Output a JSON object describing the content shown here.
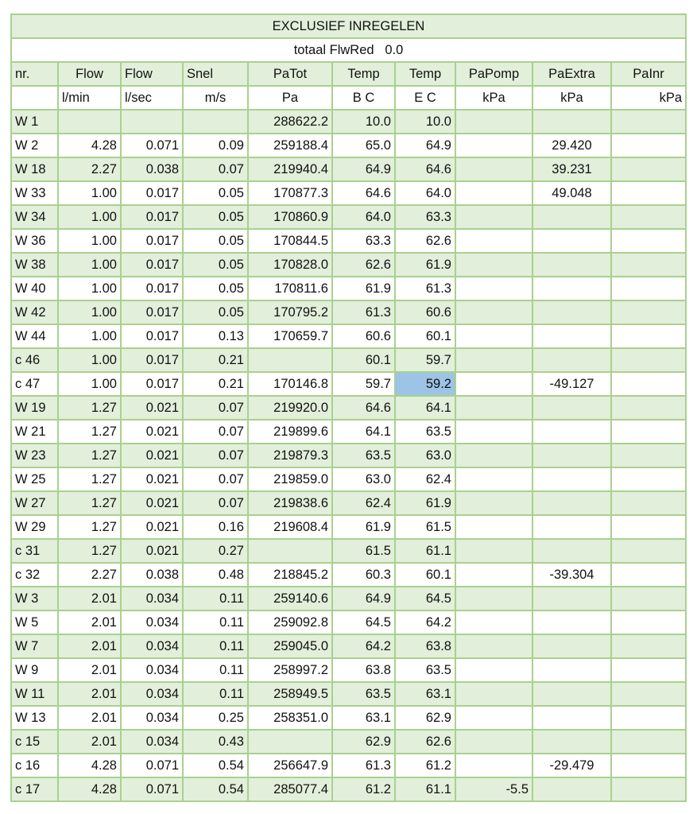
{
  "title": "EXCLUSIEF INREGELEN",
  "subtitle": "totaal FlwRed   0.0",
  "headers": [
    "nr.",
    "Flow",
    "Flow",
    "Snel",
    "PaTot",
    "Temp",
    "Temp",
    "PaPomp",
    "PaExtra",
    "PaInr"
  ],
  "units": [
    "",
    "l/min",
    "l/sec",
    "m/s",
    "Pa",
    "B C",
    "E C",
    "kPa",
    "kPa",
    "kPa"
  ],
  "rows": [
    [
      "W  1",
      "",
      "",
      "",
      "288622.2",
      "10.0",
      "10.0",
      "",
      "",
      ""
    ],
    [
      "W  2",
      "4.28",
      "0.071",
      "0.09",
      "259188.4",
      "65.0",
      "64.9",
      "",
      "29.420",
      ""
    ],
    [
      "W 18",
      "2.27",
      "0.038",
      "0.07",
      "219940.4",
      "64.9",
      "64.6",
      "",
      "39.231",
      ""
    ],
    [
      "W 33",
      "1.00",
      "0.017",
      "0.05",
      "170877.3",
      "64.6",
      "64.0",
      "",
      "49.048",
      ""
    ],
    [
      "W 34",
      "1.00",
      "0.017",
      "0.05",
      "170860.9",
      "64.0",
      "63.3",
      "",
      "",
      ""
    ],
    [
      "W 36",
      "1.00",
      "0.017",
      "0.05",
      "170844.5",
      "63.3",
      "62.6",
      "",
      "",
      ""
    ],
    [
      "W 38",
      "1.00",
      "0.017",
      "0.05",
      "170828.0",
      "62.6",
      "61.9",
      "",
      "",
      ""
    ],
    [
      "W 40",
      "1.00",
      "0.017",
      "0.05",
      "170811.6",
      "61.9",
      "61.3",
      "",
      "",
      ""
    ],
    [
      "W 42",
      "1.00",
      "0.017",
      "0.05",
      "170795.2",
      "61.3",
      "60.6",
      "",
      "",
      ""
    ],
    [
      "W 44",
      "1.00",
      "0.017",
      "0.13",
      "170659.7",
      "60.6",
      "60.1",
      "",
      "",
      ""
    ],
    [
      "c 46",
      "1.00",
      "0.017",
      "0.21",
      "",
      "60.1",
      "59.7",
      "",
      "",
      ""
    ],
    [
      "c 47",
      "1.00",
      "0.017",
      "0.21",
      "170146.8",
      "59.7",
      "59.2",
      "",
      "-49.127",
      ""
    ],
    [
      "W 19",
      "1.27",
      "0.021",
      "0.07",
      "219920.0",
      "64.6",
      "64.1",
      "",
      "",
      ""
    ],
    [
      "W 21",
      "1.27",
      "0.021",
      "0.07",
      "219899.6",
      "64.1",
      "63.5",
      "",
      "",
      ""
    ],
    [
      "W 23",
      "1.27",
      "0.021",
      "0.07",
      "219879.3",
      "63.5",
      "63.0",
      "",
      "",
      ""
    ],
    [
      "W 25",
      "1.27",
      "0.021",
      "0.07",
      "219859.0",
      "63.0",
      "62.4",
      "",
      "",
      ""
    ],
    [
      "W 27",
      "1.27",
      "0.021",
      "0.07",
      "219838.6",
      "62.4",
      "61.9",
      "",
      "",
      ""
    ],
    [
      "W 29",
      "1.27",
      "0.021",
      "0.16",
      "219608.4",
      "61.9",
      "61.5",
      "",
      "",
      ""
    ],
    [
      "c 31",
      "1.27",
      "0.021",
      "0.27",
      "",
      "61.5",
      "61.1",
      "",
      "",
      ""
    ],
    [
      "c 32",
      "2.27",
      "0.038",
      "0.48",
      "218845.2",
      "60.3",
      "60.1",
      "",
      "-39.304",
      ""
    ],
    [
      "W  3",
      "2.01",
      "0.034",
      "0.11",
      "259140.6",
      "64.9",
      "64.5",
      "",
      "",
      ""
    ],
    [
      "W  5",
      "2.01",
      "0.034",
      "0.11",
      "259092.8",
      "64.5",
      "64.2",
      "",
      "",
      ""
    ],
    [
      "W  7",
      "2.01",
      "0.034",
      "0.11",
      "259045.0",
      "64.2",
      "63.8",
      "",
      "",
      ""
    ],
    [
      "W  9",
      "2.01",
      "0.034",
      "0.11",
      "258997.2",
      "63.8",
      "63.5",
      "",
      "",
      ""
    ],
    [
      "W 11",
      "2.01",
      "0.034",
      "0.11",
      "258949.5",
      "63.5",
      "63.1",
      "",
      "",
      ""
    ],
    [
      "W 13",
      "2.01",
      "0.034",
      "0.25",
      "258351.0",
      "63.1",
      "62.9",
      "",
      "",
      ""
    ],
    [
      "c 15",
      "2.01",
      "0.034",
      "0.43",
      "",
      "62.9",
      "62.6",
      "",
      "",
      ""
    ],
    [
      "c 16",
      "4.28",
      "0.071",
      "0.54",
      "256647.9",
      "61.3",
      "61.2",
      "",
      "-29.479",
      ""
    ],
    [
      "c 17",
      "4.28",
      "0.071",
      "0.54",
      "285077.4",
      "61.2",
      "61.1",
      "-5.5",
      "",
      ""
    ]
  ],
  "colors": {
    "band": "#e2efda",
    "grid": "#a9d18e",
    "selected": "#9dc3e6"
  }
}
